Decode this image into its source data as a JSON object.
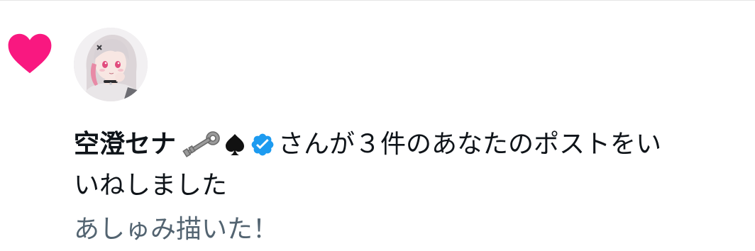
{
  "notification": {
    "user_name": "空澄セナ",
    "action_line1": "さんが３件のあなたのポストをい",
    "action_line2": "いねしました",
    "post_preview": "あしゅみ描いた！",
    "icons": {
      "type_icon": "heart-icon",
      "name_emojis": [
        "key-icon",
        "spade-icon"
      ],
      "badge": "verified-badge-icon"
    },
    "colors": {
      "heart": "#f91880",
      "verified": "#1d9bf0",
      "text_primary": "#0f1419",
      "text_secondary": "#536471"
    }
  }
}
